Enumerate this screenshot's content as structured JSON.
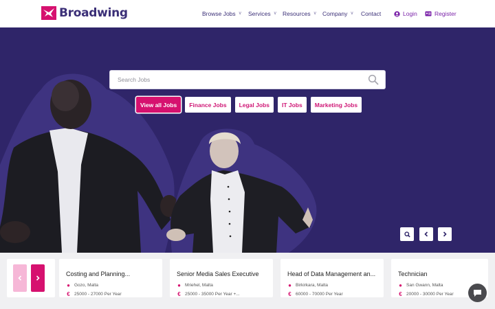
{
  "brand": {
    "name": "Broadwing",
    "color": "#d6116f",
    "text_color": "#3b2f77"
  },
  "nav": {
    "items": [
      {
        "label": "Browse Jobs",
        "dropdown": true
      },
      {
        "label": "Services",
        "dropdown": true
      },
      {
        "label": "Resources",
        "dropdown": true
      },
      {
        "label": "Company",
        "dropdown": true
      },
      {
        "label": "Contact",
        "dropdown": false
      }
    ],
    "login": "Login",
    "register": "Register"
  },
  "hero": {
    "background": "#2f2569",
    "search_placeholder": "Search Jobs",
    "chips": [
      {
        "label": "View all Jobs",
        "active": true
      },
      {
        "label": "Finance Jobs",
        "active": false
      },
      {
        "label": "Legal Jobs",
        "active": false
      },
      {
        "label": "IT Jobs",
        "active": false
      },
      {
        "label": "Marketing Jobs",
        "active": false
      }
    ],
    "controls": [
      "search-icon",
      "chevron-left-icon",
      "chevron-right-icon"
    ]
  },
  "jobs": [
    {
      "title": "Costing and Planning...",
      "location": "Gozo, Malta",
      "salary": "25000 - 27000 Per Year"
    },
    {
      "title": "Senior Media Sales Executive",
      "location": "Mriehel, Malta",
      "salary": "25000 - 35000 Per Year +..."
    },
    {
      "title": "Head of Data Management an...",
      "location": "Birkirkara, Malta",
      "salary": "60000 - 70000 Per Year"
    },
    {
      "title": "Technician",
      "location": "San Gwann, Malta",
      "salary": "20000 - 30000 Per Year"
    }
  ],
  "icons": {
    "location": "map-pin-icon",
    "salary": "euro-icon",
    "chat": "chat-bubble-icon"
  }
}
